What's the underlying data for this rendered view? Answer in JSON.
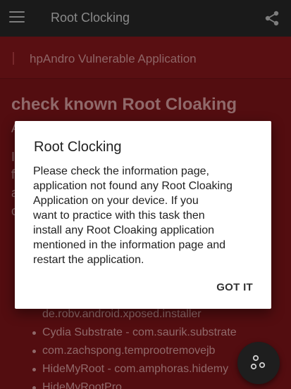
{
  "appbar": {
    "title": "Root Clocking",
    "menu_icon": "menu-icon",
    "share_icon": "share-icon"
  },
  "subbar": {
    "text": "hpAndro Vulnerable Application"
  },
  "main": {
    "heading": "check known Root Cloaking",
    "peek_letters": [
      "A",
      "I",
      "f",
      "a",
      "c"
    ],
    "list_items": [
      "de.robv.android.xposed.installer",
      "Cydia Substrate - com.saurik.substrate",
      "com.zachspong.temprootremovejb",
      "HideMyRoot - com.amphoras.hidemy",
      "HideMyRootPro"
    ]
  },
  "dialog": {
    "title": "Root Clocking",
    "body_lines": [
      "Please check the information page,",
      "application not found any Root Cloaking",
      "Application on your device. If you",
      "want to practice with this task then",
      "install any Root Cloaking application",
      "mentioned in the information page and",
      "restart the application."
    ],
    "button": "GOT IT"
  },
  "fab": {
    "icon": "scatter-dots-icon"
  },
  "colors": {
    "appbar": "#1a1a1a",
    "content": "#741317",
    "dialog": "#ffffff",
    "fab": "#1e1e1e"
  }
}
